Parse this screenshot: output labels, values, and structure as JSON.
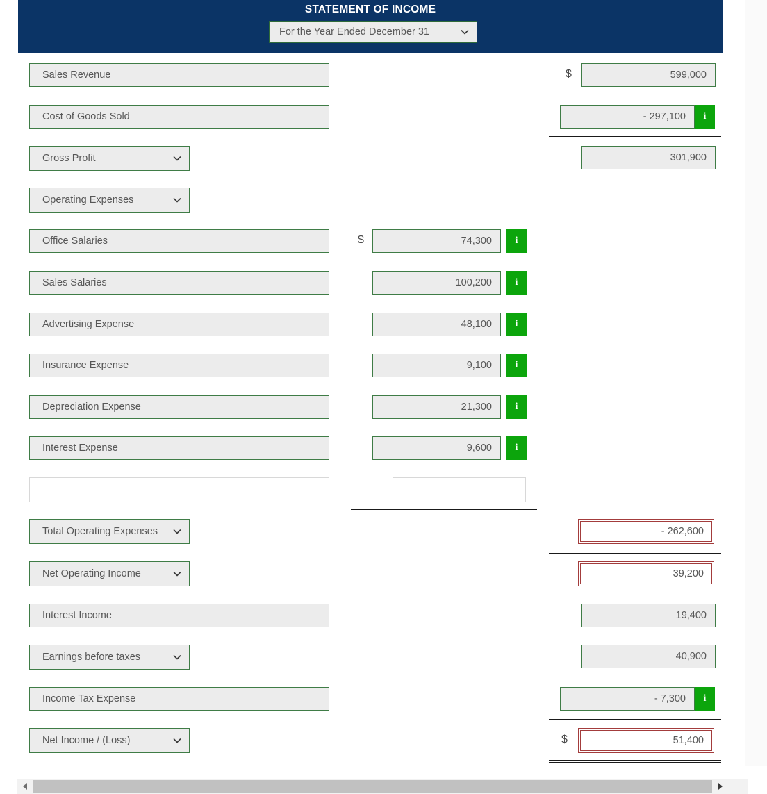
{
  "header": {
    "title": "STATEMENT OF INCOME",
    "period_select": {
      "value": "For the Year Ended December 31",
      "icon": "chevron-down-icon"
    }
  },
  "colors": {
    "header_blue": "#0b3466",
    "field_border_green": "#3f7c46",
    "field_fill": "#ececec",
    "info_green": "#0ca50c",
    "answer_red": "#a33c3c",
    "text_gray": "#575757"
  },
  "symbols": {
    "dollar": "$",
    "info": "i"
  },
  "rows": [
    {
      "key": "sales_revenue",
      "label": "Sales Revenue",
      "right_value": "599,000"
    },
    {
      "key": "cost_of_goods_sold",
      "label": "Cost of Goods Sold",
      "right_value": "- 297,100"
    },
    {
      "key": "gross_profit",
      "label": "Gross Profit",
      "right_value": "301,900"
    },
    {
      "key": "operating_expenses",
      "label": "Operating Expenses",
      "right_value": ""
    },
    {
      "key": "office_salaries",
      "label": "Office Salaries",
      "mid_value": "74,300"
    },
    {
      "key": "sales_salaries",
      "label": "Sales Salaries",
      "mid_value": "100,200"
    },
    {
      "key": "advertising_expense",
      "label": "Advertising Expense",
      "mid_value": "48,100"
    },
    {
      "key": "insurance_expense",
      "label": "Insurance Expense",
      "mid_value": "9,100"
    },
    {
      "key": "depreciation_expense",
      "label": "Depreciation Expense",
      "mid_value": "21,300"
    },
    {
      "key": "interest_expense",
      "label": "Interest Expense",
      "mid_value": "9,600"
    },
    {
      "key": "blank_row",
      "label": "",
      "mid_value": ""
    },
    {
      "key": "total_operating_expenses",
      "label": "Total Operating Expenses",
      "right_value": "- 262,600"
    },
    {
      "key": "net_operating_income",
      "label": "Net Operating Income",
      "right_value": "39,200"
    },
    {
      "key": "interest_income",
      "label": "Interest Income",
      "right_value": "19,400"
    },
    {
      "key": "earnings_before_taxes",
      "label": "Earnings before taxes",
      "right_value": "40,900"
    },
    {
      "key": "income_tax_expense",
      "label": "Income Tax Expense",
      "right_value": "- 7,300"
    },
    {
      "key": "net_income_loss",
      "label": "Net Income / (Loss)",
      "right_value": "51,400"
    }
  ],
  "scrollbar": {
    "left_arrow": "scroll-left-arrow-icon",
    "right_arrow": "scroll-right-arrow-icon"
  }
}
